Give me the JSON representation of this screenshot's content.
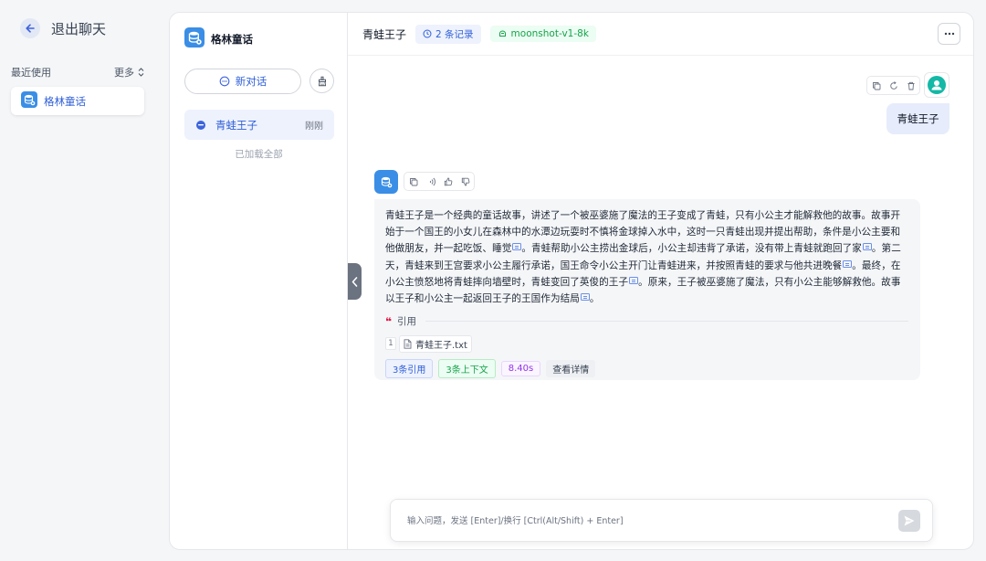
{
  "sidebar": {
    "exit_label": "退出聊天",
    "recent_label": "最近使用",
    "more_label": "更多",
    "apps": [
      {
        "name": "格林童话"
      }
    ]
  },
  "conversations": {
    "app_name": "格林童话",
    "new_chat_label": "新对话",
    "items": [
      {
        "title": "青蛙王子",
        "time": "刚刚"
      }
    ],
    "loaded_all": "已加载全部"
  },
  "chat": {
    "title": "青蛙王子",
    "records_tag": "2 条记录",
    "model_tag": "moonshot-v1-8k",
    "user_message": "青蛙王子",
    "ai_message": {
      "segments": [
        "青蛙王子是一个经典的童话故事，讲述了一个被巫婆施了魔法的王子变成了青蛙，只有小公主才能解救他的故事。故事开始于一个国王的小女儿在森林中的水潭边玩耍时不慎将金球掉入水中，这时一只青蛙出现并提出帮助，条件是小公主要和他做朋友，并一起吃饭、睡觉",
        "。青蛙帮助小公主捞出金球后，小公主却违背了承诺，没有带上青蛙就跑回了家",
        "。第二天，青蛙来到王宫要求小公主履行承诺，国王命令小公主开门让青蛙进来，并按照青蛙的要求与他共进晚餐",
        "。最终，在小公主愤怒地将青蛙摔向墙壁时，青蛙变回了英俊的王子",
        "。原来，王子被巫婆施了魔法，只有小公主能够解救他。故事以王子和小公主一起返回王子的王国作为结局",
        "。"
      ],
      "quote_label": "引用",
      "sources": [
        {
          "index": "1",
          "file": "青蛙王子.txt"
        }
      ],
      "stats": {
        "citations": "3条引用",
        "context": "3条上下文",
        "duration": "8.40s",
        "details": "查看详情"
      }
    }
  },
  "input": {
    "placeholder": "输入问题，发送 [Enter]/换行 [Ctrl(Alt/Shift) + Enter]"
  },
  "colors": {
    "accent": "#2f5fd8",
    "app_icon": "#3a8ee6",
    "user_avatar": "#14b8a6",
    "quote": "#e11d48",
    "success": "#16a34a",
    "purple": "#9333ea"
  }
}
